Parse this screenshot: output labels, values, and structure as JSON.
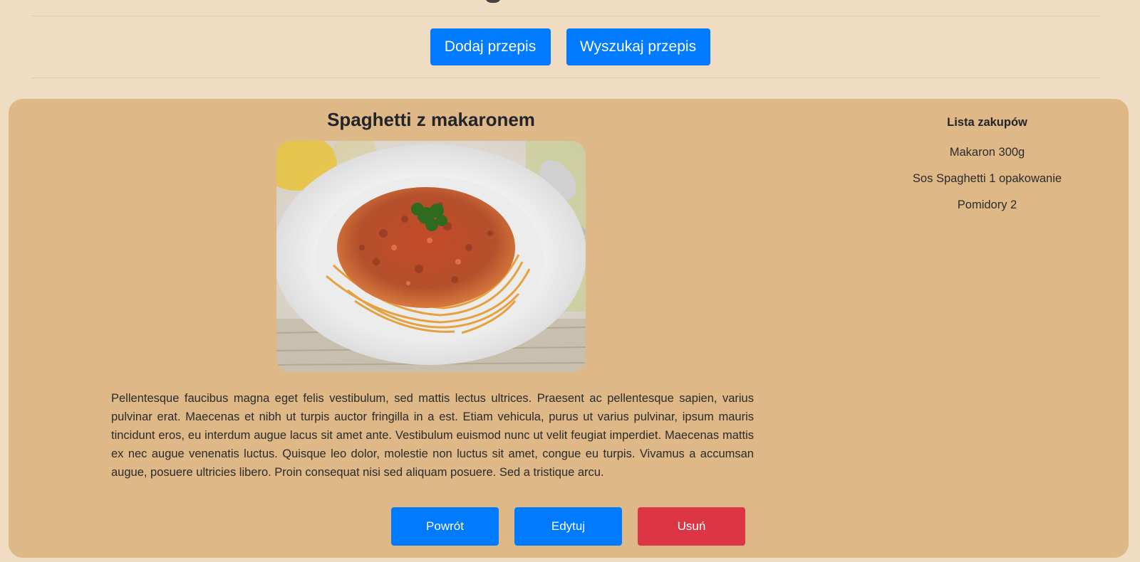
{
  "top_actions": {
    "add_recipe": "Dodaj przepis",
    "search_recipe": "Wyszukaj przepis"
  },
  "recipe": {
    "title": "Spaghetti z makaronem",
    "description": "Pellentesque faucibus magna eget felis vestibulum, sed mattis lectus ultrices. Praesent ac pellentesque sapien, varius pulvinar erat. Maecenas et nibh ut turpis auctor fringilla in a est. Etiam vehicula, purus ut varius pulvinar, ipsum mauris tincidunt eros, eu interdum augue lacus sit amet ante. Vestibulum euismod nunc ut velit feugiat imperdiet. Maecenas mattis ex nec augue venenatis luctus. Quisque leo dolor, molestie non luctus sit amet, congue eu turpis. Vivamus a accumsan augue, posuere ultricies libero. Proin consequat nisi sed aliquam posuere. Sed a tristique arcu."
  },
  "shopping_list": {
    "heading": "Lista zakupów",
    "items": [
      "Makaron 300g",
      "Sos Spaghetti 1 opakowanie",
      "Pomidory 2"
    ]
  },
  "bottom_actions": {
    "back": "Powrót",
    "edit": "Edytuj",
    "delete": "Usuń"
  },
  "colors": {
    "page_background": "#f0dcc2",
    "card_background": "#deb887",
    "primary_button": "#007bff",
    "danger_button": "#dc3545"
  }
}
